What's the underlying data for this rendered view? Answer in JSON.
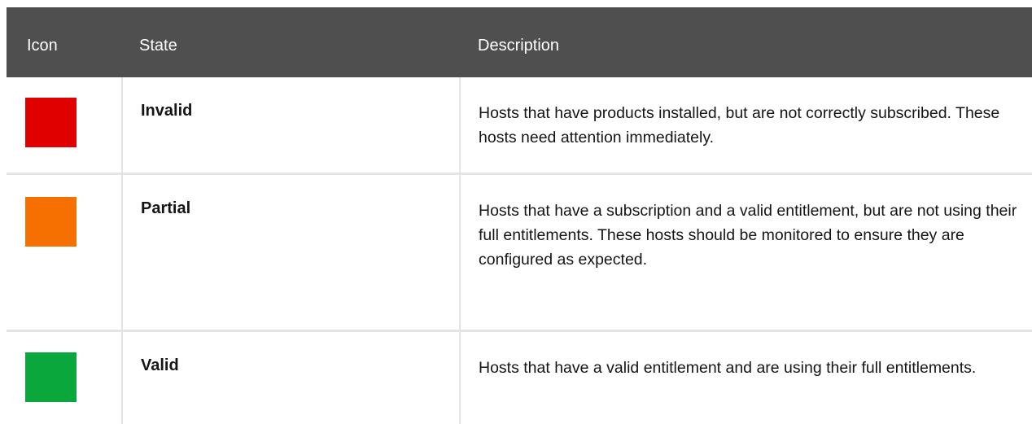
{
  "table": {
    "headers": {
      "icon": "Icon",
      "state": "State",
      "description": "Description"
    },
    "rows": [
      {
        "color": "#e00000",
        "state": "Invalid",
        "description": "Hosts that have products installed, but are not correctly subscribed. These hosts need attention immediately."
      },
      {
        "color": "#f57000",
        "state": "Partial",
        "description": "Hosts that have a subscription and a valid entitlement, but are not using their full entitlements. These hosts should be monitored to ensure they are configured as expected."
      },
      {
        "color": "#0aa83c",
        "state": "Valid",
        "description": "Hosts that have a valid entitlement and are using their full entitlements."
      }
    ]
  }
}
